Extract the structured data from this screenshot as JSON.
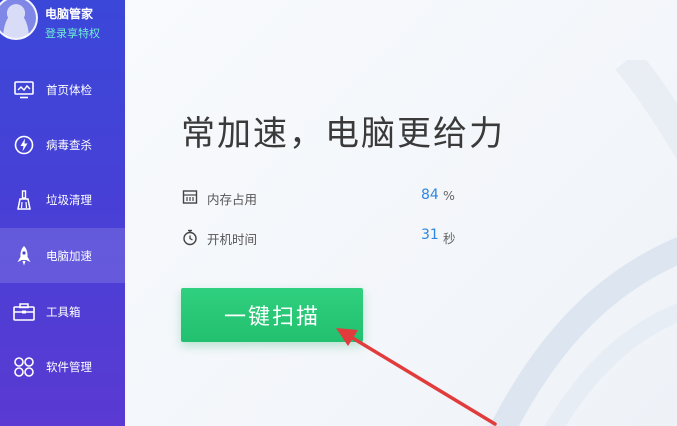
{
  "sidebar": {
    "app_name": "电脑管家",
    "login_text": "登录享特权",
    "items": [
      {
        "label": "首页体检",
        "icon": "monitor-icon"
      },
      {
        "label": "病毒查杀",
        "icon": "lightning-shield-icon"
      },
      {
        "label": "垃圾清理",
        "icon": "broom-icon"
      },
      {
        "label": "电脑加速",
        "icon": "rocket-icon",
        "active": true
      },
      {
        "label": "工具箱",
        "icon": "toolbox-icon"
      },
      {
        "label": "软件管理",
        "icon": "apps-icon"
      }
    ]
  },
  "main": {
    "headline": "常加速，电脑更给力",
    "stats": [
      {
        "label": "内存占用",
        "value": "84",
        "unit": "%",
        "icon": "memory-icon"
      },
      {
        "label": "开机时间",
        "value": "31",
        "unit": "秒",
        "icon": "stopwatch-icon"
      }
    ],
    "scan_button_label": "一键扫描"
  },
  "colors": {
    "sidebar": "#3f45d7",
    "accent_green": "#27c574",
    "value_blue": "#2d87e0",
    "arrow_red": "#e23b3b"
  }
}
